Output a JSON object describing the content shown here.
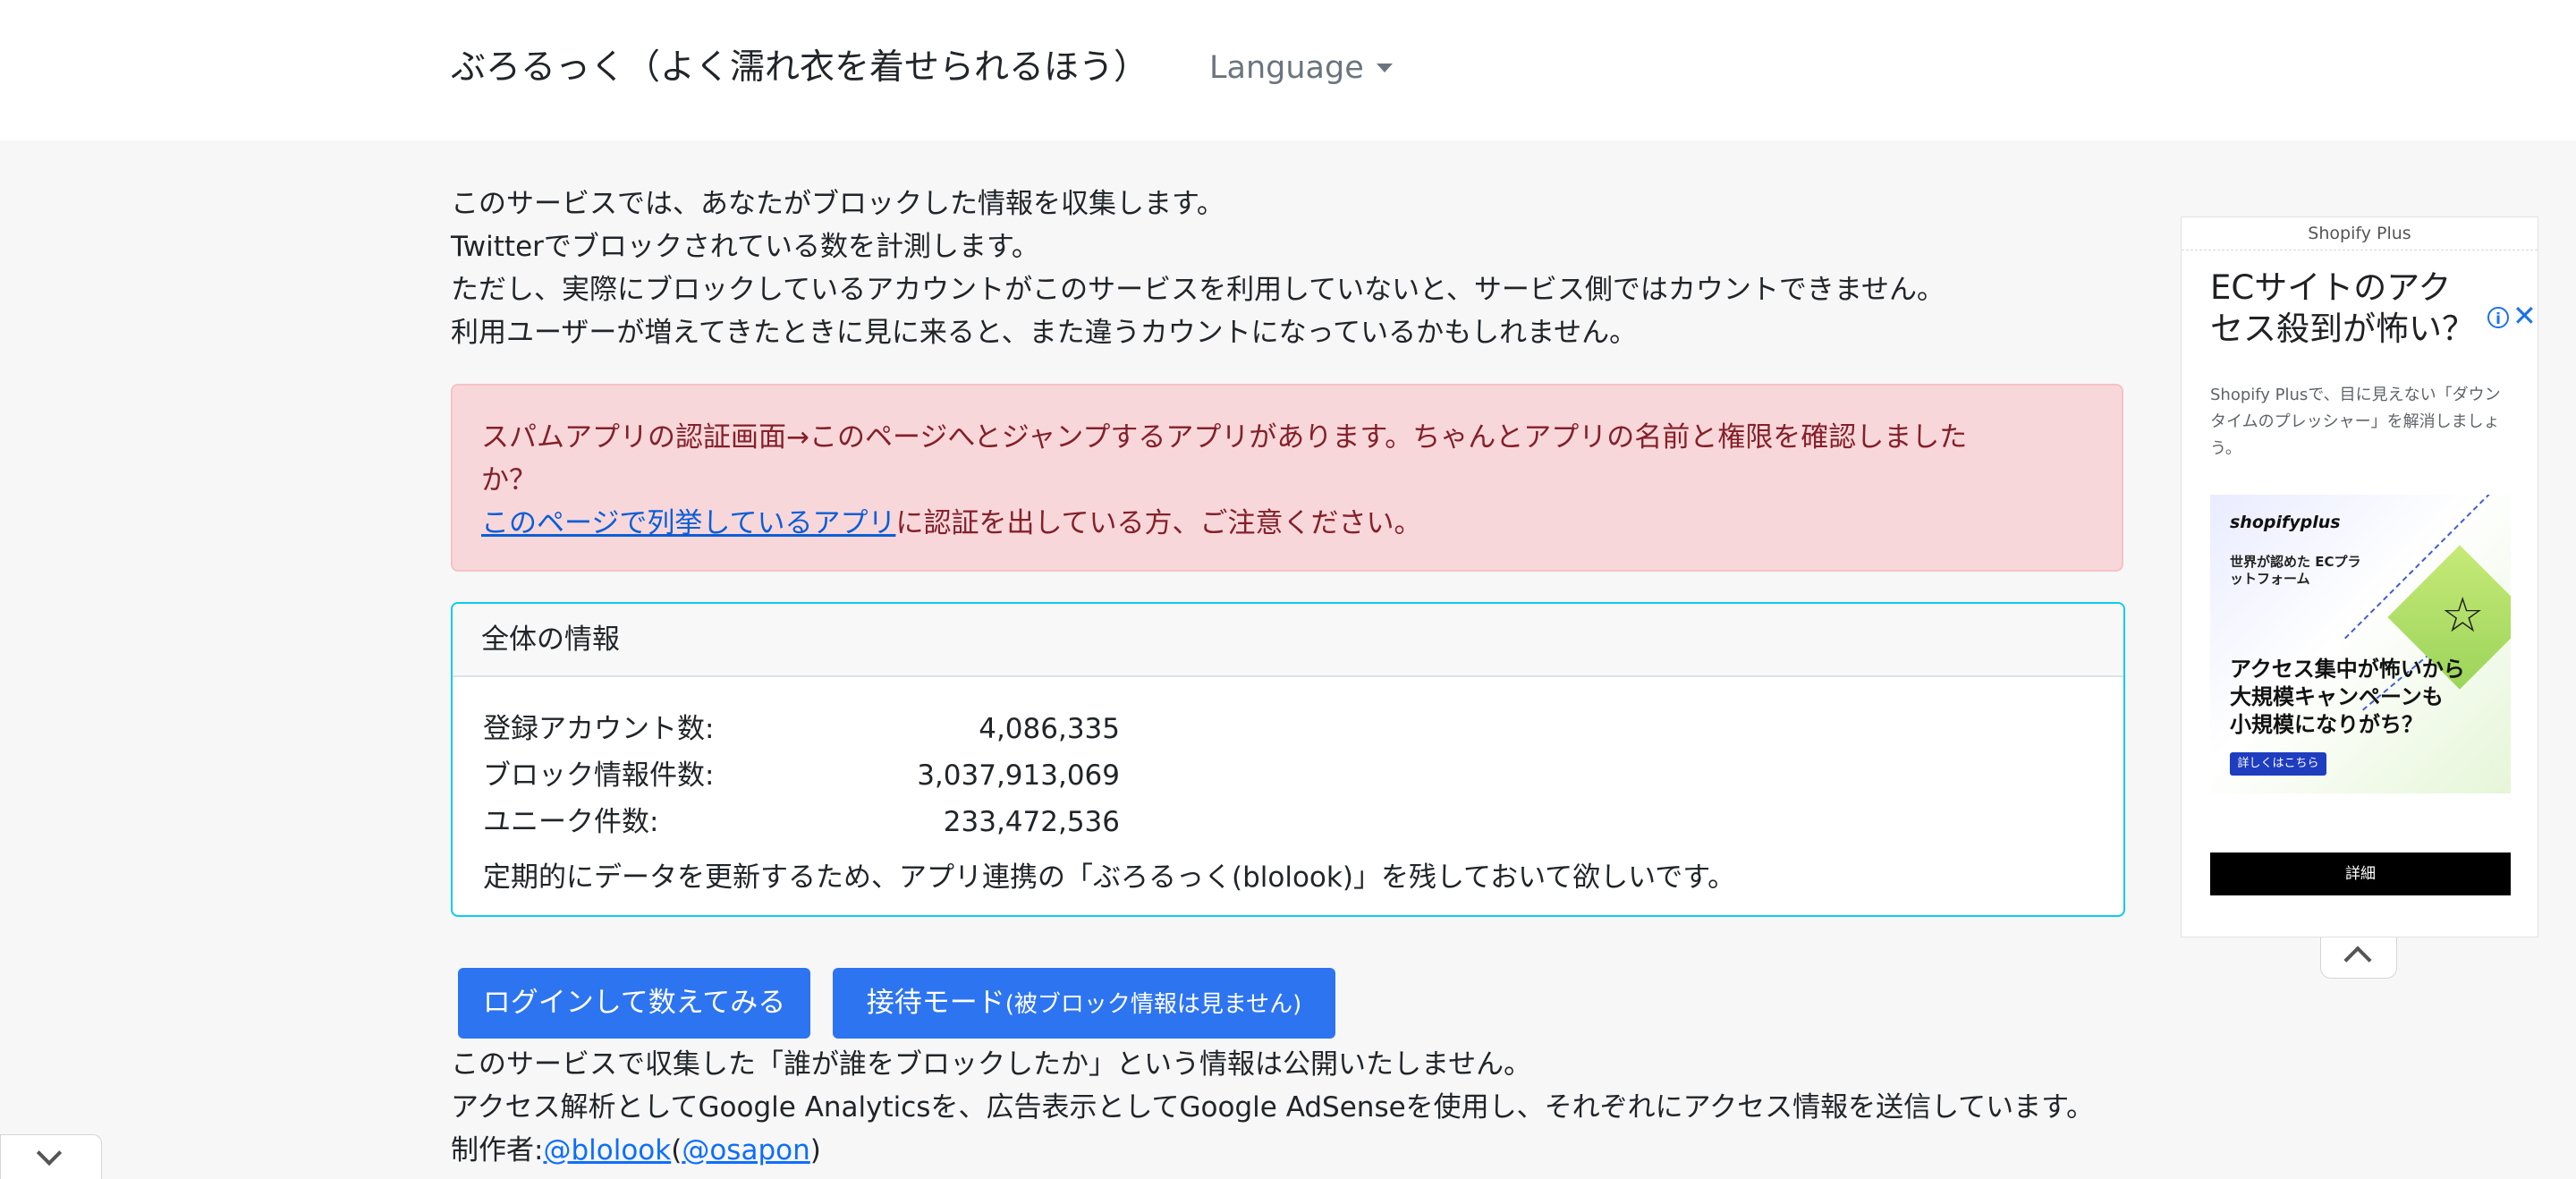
{
  "navbar": {
    "brand": "ぶろるっく（よく濡れ衣を着せられるほう）",
    "language_label": "Language"
  },
  "intro": {
    "lines": [
      "このサービスでは、あなたがブロックした情報を収集します。",
      "Twitterでブロックされている数を計測します。",
      "ただし、実際にブロックしているアカウントがこのサービスを利用していないと、サービス側ではカウントできません。",
      "利用ユーザーが増えてきたときに見に来ると、また違うカウントになっているかもしれません。"
    ]
  },
  "alert": {
    "line1": "スパムアプリの認証画面→このページへとジャンプするアプリがあります。ちゃんとアプリの名前と権限を確認しました",
    "line2": "か？",
    "link_text": "このページで列挙しているアプリ",
    "line3_rest": "に認証を出している方、ご注意ください。",
    "colors": {
      "background": "#f8d7da",
      "text": "#842029"
    }
  },
  "overview": {
    "header": "全体の情報",
    "stats": [
      {
        "label": "登録アカウント数:",
        "value": "4,086,335"
      },
      {
        "label": "ブロック情報件数:",
        "value": "3,037,913,069"
      },
      {
        "label": "ユニーク件数:",
        "value": "233,472,536"
      }
    ],
    "note": "定期的にデータを更新するため、アプリ連携の「ぶろるっく(blolook)」を残しておいて欲しいです。",
    "border_color": "#0dcaf0"
  },
  "buttons": {
    "login": "ログインして数えてみる",
    "guest_main": "接待モード",
    "guest_note": "(被ブロック情報は見ません)",
    "color": "#2d74f1"
  },
  "footer": {
    "privacy": "このサービスで収集した「誰が誰をブロックしたか」という情報は公開いたしません。",
    "analytics": "アクセス解析としてGoogle Analyticsを、広告表示としてGoogle AdSenseを使用し、それぞれにアクセス情報を送信しています。",
    "author_prefix": "制作者:",
    "author_link1": "@blolook",
    "author_paren_open": "(",
    "author_link2": "@osapon",
    "author_paren_close": ")"
  },
  "ad": {
    "advertiser": "Shopify Plus",
    "headline": "ECサイトのアクセス殺到が怖い？",
    "description": "Shopify Plusで、目に見えない「ダウンタイムのプレッシャー」を解消しましょう。",
    "info_icon": "i",
    "close_icon": "✕",
    "image_logo": "shopifyplus",
    "image_sub": "世界が認めた ECプラットフォーム",
    "image_copy": [
      "アクセス集中が怖いから",
      "大規模キャンペーンも",
      "小規模になりがち？"
    ],
    "image_button": "詳しくはこちら",
    "star": "☆",
    "cta": "詳細"
  },
  "icons": {
    "caret": "caret-down-icon",
    "collapse": "chevron-up-icon",
    "expand": "chevron-down-icon"
  }
}
